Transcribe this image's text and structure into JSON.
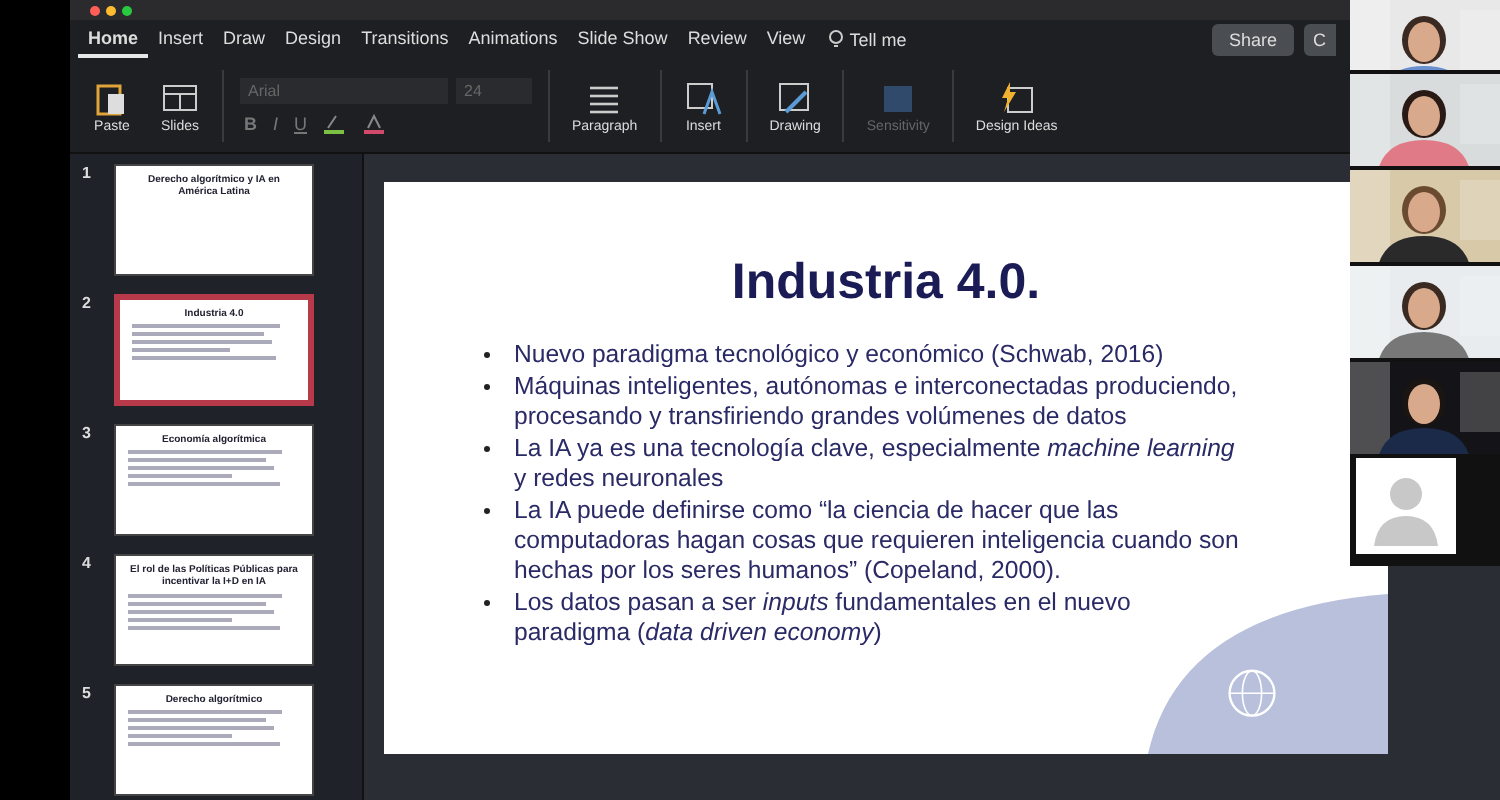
{
  "ribbon_tabs": [
    {
      "label": "Home",
      "selected": true
    },
    {
      "label": "Insert",
      "selected": false
    },
    {
      "label": "Draw",
      "selected": false
    },
    {
      "label": "Design",
      "selected": false
    },
    {
      "label": "Transitions",
      "selected": false
    },
    {
      "label": "Animations",
      "selected": false
    },
    {
      "label": "Slide Show",
      "selected": false
    },
    {
      "label": "Review",
      "selected": false
    },
    {
      "label": "View",
      "selected": false
    }
  ],
  "tell_me": "Tell me",
  "share_button": "Share",
  "comments_button": "C",
  "ribbon": {
    "font": "Arial",
    "size": "24",
    "format_buttons": [
      "B",
      "I",
      "U"
    ],
    "groups": [
      {
        "kind": "paste",
        "label": "Paste",
        "disabled": false
      },
      {
        "kind": "slides",
        "label": "Slides",
        "disabled": false
      },
      {
        "kind": "paragraph",
        "label": "Paragraph",
        "disabled": false
      },
      {
        "kind": "insert",
        "label": "Insert",
        "disabled": false
      },
      {
        "kind": "drawing",
        "label": "Drawing",
        "disabled": false
      },
      {
        "kind": "sensitivity",
        "label": "Sensitivity",
        "disabled": true
      },
      {
        "kind": "ideas",
        "label": "Design Ideas",
        "disabled": false
      }
    ]
  },
  "thumbnails": [
    {
      "number": "1",
      "title": "Derecho algorítmico y IA en América Latina",
      "selected": false
    },
    {
      "number": "2",
      "title": "Industria 4.0",
      "selected": true
    },
    {
      "number": "3",
      "title": "Economía algorítmica",
      "selected": false
    },
    {
      "number": "4",
      "title": "El rol de las Políticas Públicas para incentivar la I+D en IA",
      "selected": false
    },
    {
      "number": "5",
      "title": "Derecho algorítmico",
      "selected": false
    }
  ],
  "slide": {
    "title": "Industria 4.0.",
    "bullets": [
      "Nuevo paradigma tecnológico y económico (Schwab, 2016)",
      "Máquinas inteligentes, autónomas e interconectadas produciendo, procesando y transfiriendo grandes volúmenes de datos",
      "La IA ya es una tecnología clave, especialmente *machine learning* y redes neuronales",
      "La IA puede definirse como “la ciencia de hacer que las computadoras hagan cosas que requieren inteligencia cuando son hechas por los seres humanos” (Copeland, 2000).",
      "Los datos pasan a ser *inputs* fundamentales en el nuevo paradigma (*data driven economy*)"
    ]
  },
  "participants": [
    {
      "kind": "picture"
    },
    {
      "kind": "picture"
    },
    {
      "kind": "picture"
    },
    {
      "kind": "picture"
    },
    {
      "kind": "picture"
    },
    {
      "kind": "avatar"
    }
  ]
}
